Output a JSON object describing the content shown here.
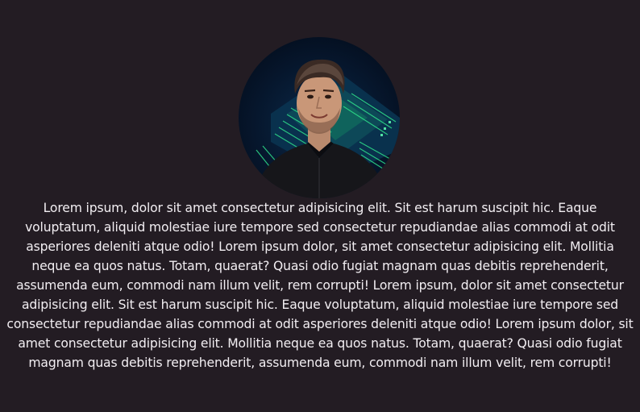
{
  "profile": {
    "bio": "Lorem ipsum, dolor sit amet consectetur adipisicing elit. Sit est harum suscipit hic. Eaque voluptatum, aliquid molestiae iure tempore sed consectetur repudiandae alias commodi at odit asperiores deleniti atque odio! Lorem ipsum dolor, sit amet consectetur adipisicing elit. Mollitia neque ea quos natus. Totam, quaerat? Quasi odio fugiat magnam quas debitis reprehenderit, assumenda eum, commodi nam illum velit, rem corrupti! Lorem ipsum, dolor sit amet consectetur adipisicing elit. Sit est harum suscipit hic. Eaque voluptatum, aliquid molestiae iure tempore sed consectetur repudiandae alias commodi at odit asperiores deleniti atque odio! Lorem ipsum dolor, sit amet consectetur adipisicing elit. Mollitia neque ea quos natus. Totam, quaerat? Quasi odio fugiat magnam quas debitis reprehenderit, assumenda eum, commodi nam illum velit, rem corrupti!"
  },
  "colors": {
    "background": "#231c23",
    "text": "#f2eef2",
    "circuit_glow": "#2fe08a"
  }
}
